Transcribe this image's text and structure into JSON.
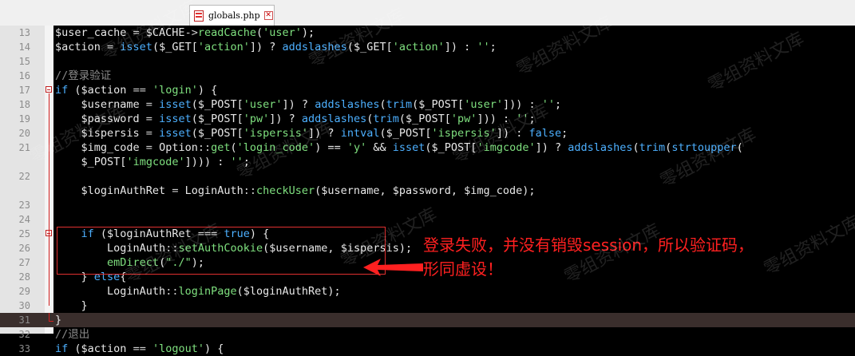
{
  "tab": {
    "filename": "globals.php",
    "close_glyph": "✕"
  },
  "lines": [
    {
      "n": "13",
      "fold": "",
      "tokens": [
        [
          "var",
          "$user_cache"
        ],
        [
          "op",
          " = "
        ],
        [
          "var",
          "$CACHE"
        ],
        [
          "op",
          "->"
        ],
        [
          "fn",
          "readCache"
        ],
        [
          "pun",
          "("
        ],
        [
          "str",
          "'user'"
        ],
        [
          "pun",
          ");"
        ]
      ]
    },
    {
      "n": "14",
      "fold": "",
      "tokens": [
        [
          "var",
          "$action"
        ],
        [
          "op",
          " = "
        ],
        [
          "kw",
          "isset"
        ],
        [
          "pun",
          "("
        ],
        [
          "var",
          "$_GET"
        ],
        [
          "pun",
          "["
        ],
        [
          "str",
          "'action'"
        ],
        [
          "pun",
          "]) ? "
        ],
        [
          "kw",
          "addslashes"
        ],
        [
          "pun",
          "("
        ],
        [
          "var",
          "$_GET"
        ],
        [
          "pun",
          "["
        ],
        [
          "str",
          "'action'"
        ],
        [
          "pun",
          "]) : "
        ],
        [
          "str",
          "''"
        ],
        [
          "pun",
          ";"
        ]
      ]
    },
    {
      "n": "15",
      "fold": "",
      "tokens": []
    },
    {
      "n": "16",
      "fold": "",
      "tokens": [
        [
          "cm",
          "//登录验证"
        ]
      ]
    },
    {
      "n": "17",
      "fold": "box",
      "tokens": [
        [
          "kw",
          "if"
        ],
        [
          "pun",
          " ("
        ],
        [
          "var",
          "$action"
        ],
        [
          "op",
          " == "
        ],
        [
          "str",
          "'login'"
        ],
        [
          "pun",
          ") {"
        ]
      ]
    },
    {
      "n": "18",
      "fold": "",
      "tokens": [
        [
          "pun",
          "    "
        ],
        [
          "var",
          "$username"
        ],
        [
          "op",
          " = "
        ],
        [
          "kw",
          "isset"
        ],
        [
          "pun",
          "("
        ],
        [
          "var",
          "$_POST"
        ],
        [
          "pun",
          "["
        ],
        [
          "str",
          "'user'"
        ],
        [
          "pun",
          "]) ? "
        ],
        [
          "kw",
          "addslashes"
        ],
        [
          "pun",
          "("
        ],
        [
          "kw",
          "trim"
        ],
        [
          "pun",
          "("
        ],
        [
          "var",
          "$_POST"
        ],
        [
          "pun",
          "["
        ],
        [
          "str",
          "'user'"
        ],
        [
          "pun",
          "])) : "
        ],
        [
          "str",
          "''"
        ],
        [
          "pun",
          ";"
        ]
      ]
    },
    {
      "n": "19",
      "fold": "",
      "tokens": [
        [
          "pun",
          "    "
        ],
        [
          "var",
          "$password"
        ],
        [
          "op",
          " = "
        ],
        [
          "kw",
          "isset"
        ],
        [
          "pun",
          "("
        ],
        [
          "var",
          "$_POST"
        ],
        [
          "pun",
          "["
        ],
        [
          "str",
          "'pw'"
        ],
        [
          "pun",
          "]) ? "
        ],
        [
          "kw",
          "addslashes"
        ],
        [
          "pun",
          "("
        ],
        [
          "kw",
          "trim"
        ],
        [
          "pun",
          "("
        ],
        [
          "var",
          "$_POST"
        ],
        [
          "pun",
          "["
        ],
        [
          "str",
          "'pw'"
        ],
        [
          "pun",
          "])) : "
        ],
        [
          "str",
          "''"
        ],
        [
          "pun",
          ";"
        ]
      ]
    },
    {
      "n": "20",
      "fold": "",
      "tokens": [
        [
          "pun",
          "    "
        ],
        [
          "var",
          "$ispersis"
        ],
        [
          "op",
          " = "
        ],
        [
          "kw",
          "isset"
        ],
        [
          "pun",
          "("
        ],
        [
          "var",
          "$_POST"
        ],
        [
          "pun",
          "["
        ],
        [
          "str",
          "'ispersis'"
        ],
        [
          "pun",
          "]) ? "
        ],
        [
          "kw",
          "intval"
        ],
        [
          "pun",
          "("
        ],
        [
          "var",
          "$_POST"
        ],
        [
          "pun",
          "["
        ],
        [
          "str",
          "'ispersis'"
        ],
        [
          "pun",
          "]) : "
        ],
        [
          "bool",
          "false"
        ],
        [
          "pun",
          ";"
        ]
      ]
    },
    {
      "n": "21",
      "fold": "",
      "tokens": [
        [
          "pun",
          "    "
        ],
        [
          "var",
          "$img_code"
        ],
        [
          "op",
          " = "
        ],
        [
          "var",
          "Option"
        ],
        [
          "op",
          "::"
        ],
        [
          "fn",
          "get"
        ],
        [
          "pun",
          "("
        ],
        [
          "str",
          "'login_code'"
        ],
        [
          "pun",
          ") == "
        ],
        [
          "str",
          "'y'"
        ],
        [
          "pun",
          " && "
        ],
        [
          "kw",
          "isset"
        ],
        [
          "pun",
          "("
        ],
        [
          "var",
          "$_POST"
        ],
        [
          "pun",
          "["
        ],
        [
          "str",
          "'imgcode'"
        ],
        [
          "pun",
          "]) ? "
        ],
        [
          "kw",
          "addslashes"
        ],
        [
          "pun",
          "("
        ],
        [
          "kw",
          "trim"
        ],
        [
          "pun",
          "("
        ],
        [
          "kw",
          "strtoupper"
        ],
        [
          "pun",
          "("
        ]
      ]
    },
    {
      "n": "",
      "fold": "",
      "tokens": [
        [
          "pun",
          "    "
        ],
        [
          "var",
          "$_POST"
        ],
        [
          "pun",
          "["
        ],
        [
          "str",
          "'imgcode'"
        ],
        [
          "pun",
          "]))) : "
        ],
        [
          "str",
          "''"
        ],
        [
          "pun",
          ";"
        ]
      ]
    },
    {
      "n": "22",
      "fold": "",
      "tokens": []
    },
    {
      "n": "",
      "fold": "",
      "tokens": [
        [
          "pun",
          "    "
        ],
        [
          "var",
          "$loginAuthRet"
        ],
        [
          "op",
          " = "
        ],
        [
          "var",
          "LoginAuth"
        ],
        [
          "op",
          "::"
        ],
        [
          "fn",
          "checkUser"
        ],
        [
          "pun",
          "("
        ],
        [
          "var",
          "$username"
        ],
        [
          "pun",
          ", "
        ],
        [
          "var",
          "$password"
        ],
        [
          "pun",
          ", "
        ],
        [
          "var",
          "$img_code"
        ],
        [
          "pun",
          ");"
        ]
      ]
    },
    {
      "n": "23",
      "fold": "",
      "tokens": []
    },
    {
      "n": "24",
      "fold": "",
      "tokens": []
    },
    {
      "n": "25",
      "fold": "box",
      "tokens": [
        [
          "pun",
          "    "
        ],
        [
          "kw",
          "if"
        ],
        [
          "pun",
          " ("
        ],
        [
          "var",
          "$loginAuthRet"
        ],
        [
          "op",
          " === "
        ],
        [
          "bool",
          "true"
        ],
        [
          "pun",
          ") {"
        ]
      ]
    },
    {
      "n": "26",
      "fold": "",
      "tokens": [
        [
          "pun",
          "        "
        ],
        [
          "var",
          "LoginAuth"
        ],
        [
          "op",
          "::"
        ],
        [
          "fn",
          "setAuthCookie"
        ],
        [
          "pun",
          "("
        ],
        [
          "var",
          "$username"
        ],
        [
          "pun",
          ", "
        ],
        [
          "var",
          "$ispersis"
        ],
        [
          "pun",
          ");"
        ]
      ]
    },
    {
      "n": "27",
      "fold": "",
      "tokens": [
        [
          "pun",
          "        "
        ],
        [
          "fn",
          "emDirect"
        ],
        [
          "pun",
          "("
        ],
        [
          "str",
          "\"./\""
        ],
        [
          "pun",
          ");"
        ]
      ]
    },
    {
      "n": "28",
      "fold": "",
      "tokens": [
        [
          "pun",
          "    } "
        ],
        [
          "kw",
          "else"
        ],
        [
          "pun",
          "{"
        ]
      ]
    },
    {
      "n": "29",
      "fold": "",
      "tokens": [
        [
          "pun",
          "        "
        ],
        [
          "var",
          "LoginAuth"
        ],
        [
          "op",
          "::"
        ],
        [
          "fn",
          "loginPage"
        ],
        [
          "pun",
          "("
        ],
        [
          "var",
          "$loginAuthRet"
        ],
        [
          "pun",
          ");"
        ]
      ]
    },
    {
      "n": "30",
      "fold": "",
      "tokens": [
        [
          "pun",
          "    }"
        ]
      ]
    },
    {
      "n": "31",
      "fold": "end",
      "tokens": [
        [
          "pun",
          "}"
        ]
      ]
    },
    {
      "n": "32",
      "fold": "",
      "tokens": [
        [
          "cm",
          "//退出"
        ]
      ]
    },
    {
      "n": "33",
      "fold": "",
      "tokens": [
        [
          "kw",
          "if"
        ],
        [
          "pun",
          " ("
        ],
        [
          "var",
          "$action"
        ],
        [
          "op",
          " == "
        ],
        [
          "str",
          "'logout'"
        ],
        [
          "pun",
          ") {"
        ]
      ]
    }
  ],
  "annotation": {
    "line1": "登录失败，并没有销毁session，所以验证码，",
    "line2": "形同虚设！"
  },
  "watermark_text": "零组资料文库",
  "colors": {
    "annotation": "#ff2020",
    "box": "#e03030"
  }
}
